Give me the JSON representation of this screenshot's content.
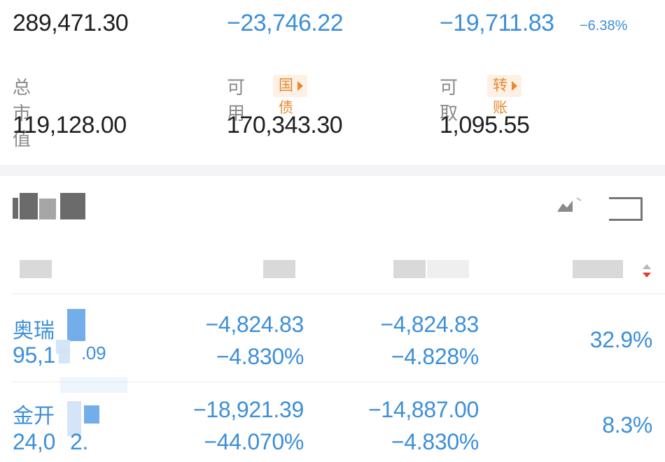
{
  "summary_top": {
    "total_assets": "289,471.30",
    "floating_pl": "−23,746.22",
    "daily_pl": "−19,711.83",
    "daily_pl_pct": "−6.38%"
  },
  "labels": {
    "market_value": "总市值",
    "available": "可用",
    "available_tag": "国债",
    "withdrawable": "可取",
    "withdrawable_tag": "转账"
  },
  "summary_bottom": {
    "market_value": "119,128.00",
    "available": "170,343.30",
    "withdrawable": "1,095.55"
  },
  "positions": [
    {
      "name_partial": "奥瑞",
      "value_partial": "95,1",
      "value_tail": ".09",
      "floating_pl": "−4,824.83",
      "floating_pl_pct": "−4.830%",
      "daily_pl": "−4,824.83",
      "daily_pl_pct": "−4.828%",
      "weight": "32.9%"
    },
    {
      "name_partial": "金开",
      "value_partial": "24,0",
      "value_tail": "2.",
      "floating_pl": "−18,921.39",
      "floating_pl_pct": "−44.070%",
      "daily_pl": "−14,887.00",
      "daily_pl_pct": "−4.830%",
      "weight": "8.3%"
    }
  ],
  "colors": {
    "loss_blue": "#3d8fd8",
    "tag_orange": "#e58a32",
    "sort_down_red": "#e53935"
  },
  "icons": [
    "chart-icon",
    "fullscreen-icon",
    "sort-icon",
    "arrow-right-icon"
  ]
}
